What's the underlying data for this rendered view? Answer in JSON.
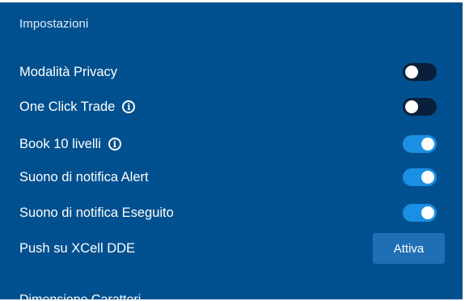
{
  "panel": {
    "title": "Impostazioni"
  },
  "settings": [
    {
      "label": "Modalità Privacy",
      "has_info": false,
      "control": "toggle",
      "state": "off"
    },
    {
      "label": "One Click Trade",
      "has_info": true,
      "control": "toggle",
      "state": "off"
    },
    {
      "label": "Book 10 livelli",
      "has_info": true,
      "control": "toggle",
      "state": "on"
    },
    {
      "label": "Suono di notifica Alert",
      "has_info": false,
      "control": "toggle",
      "state": "on"
    },
    {
      "label": "Suono di notifica Eseguito",
      "has_info": false,
      "control": "toggle",
      "state": "on"
    },
    {
      "label": "Push su XCell DDE",
      "has_info": false,
      "control": "button",
      "button_label": "Attiva"
    }
  ],
  "next_section": {
    "title_partial": "Dimensione Caratteri"
  },
  "icons": {
    "info": "info-icon"
  },
  "colors": {
    "panel_bg": "#00508f",
    "toggle_on": "#1a8fe3",
    "toggle_off": "#0b1f3a",
    "button_bg": "#1f6fb5",
    "text": "#ffffff"
  }
}
